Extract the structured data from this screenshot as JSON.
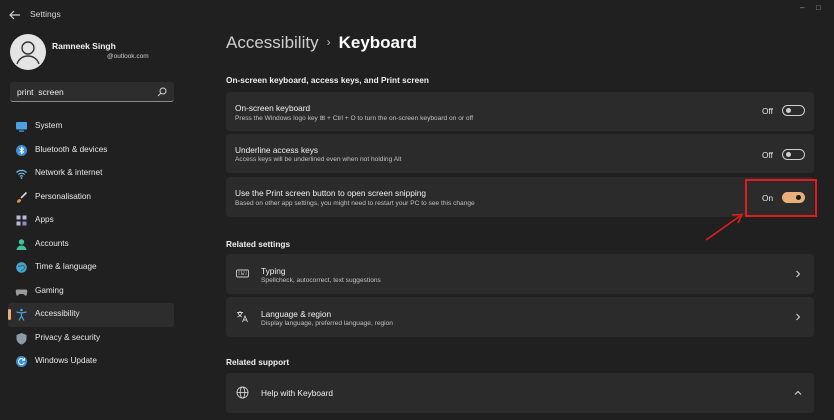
{
  "window": {
    "title": "Settings"
  },
  "user": {
    "name": "Ramneek Singh",
    "email": "@outlook.com"
  },
  "search": {
    "value": "print  screen"
  },
  "sidebar": {
    "items": [
      {
        "label": "System",
        "icon": "system-icon",
        "active": false
      },
      {
        "label": "Bluetooth & devices",
        "icon": "bluetooth-icon",
        "active": false
      },
      {
        "label": "Network & internet",
        "icon": "network-icon",
        "active": false
      },
      {
        "label": "Personalisation",
        "icon": "brush-icon",
        "active": false
      },
      {
        "label": "Apps",
        "icon": "apps-icon",
        "active": false
      },
      {
        "label": "Accounts",
        "icon": "accounts-icon",
        "active": false
      },
      {
        "label": "Time & language",
        "icon": "globe-icon",
        "active": false
      },
      {
        "label": "Gaming",
        "icon": "gaming-icon",
        "active": false
      },
      {
        "label": "Accessibility",
        "icon": "accessibility-icon",
        "active": true
      },
      {
        "label": "Privacy & security",
        "icon": "shield-icon",
        "active": false
      },
      {
        "label": "Windows Update",
        "icon": "update-icon",
        "active": false
      }
    ]
  },
  "breadcrumb": {
    "parent": "Accessibility",
    "separator": "›",
    "current": "Keyboard"
  },
  "sections": {
    "onscreen": "On-screen keyboard, access keys, and Print screen",
    "related_settings": "Related settings",
    "related_support": "Related support"
  },
  "settings": [
    {
      "title": "On-screen keyboard",
      "desc": "Press the Windows logo key ⊞ + Ctrl + O to turn the on-screen keyboard on or off",
      "state": "Off",
      "on": false
    },
    {
      "title": "Underline access keys",
      "desc": "Access keys will be underlined even when not holding Alt",
      "state": "Off",
      "on": false
    },
    {
      "title": "Use the Print screen button to open screen snipping",
      "desc": "Based on other app settings, you might need to restart your PC to see this change",
      "state": "On",
      "on": true
    }
  ],
  "related": [
    {
      "title": "Typing",
      "desc": "Spellcheck, autocorrect, text suggestions",
      "icon": "keyboard-icon"
    },
    {
      "title": "Language & region",
      "desc": "Display language, preferred language, region",
      "icon": "language-icon"
    }
  ],
  "support": {
    "title": "Help with Keyboard",
    "icon": "globe-icon"
  },
  "colors": {
    "accent": "#e7b07a",
    "highlight": "#e11c1c",
    "background": "#202020",
    "card": "#2b2b2b"
  }
}
